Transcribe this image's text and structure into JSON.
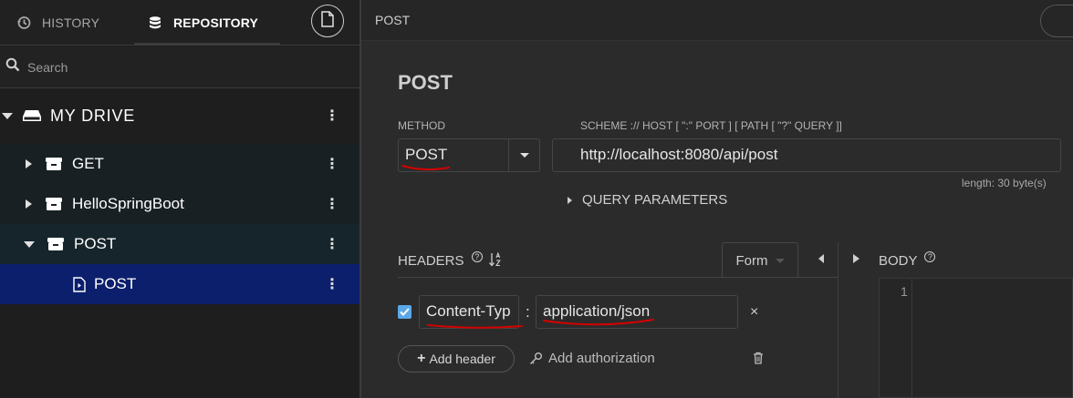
{
  "sidebar": {
    "tabs": {
      "history": "HISTORY",
      "repository": "REPOSITORY"
    },
    "search_placeholder": "Search",
    "drive_label": "MY DRIVE",
    "tree": [
      {
        "label": "GET",
        "expanded": false
      },
      {
        "label": "HelloSpringBoot",
        "expanded": false
      },
      {
        "label": "POST",
        "expanded": true
      }
    ],
    "selected_request": "POST"
  },
  "topbar": {
    "title": "POST"
  },
  "request": {
    "title": "POST",
    "method_label": "METHOD",
    "method": "POST",
    "url_label": "SCHEME :// HOST [ \":\" PORT ] [ PATH [ \"?\" QUERY ]]",
    "url": "http://localhost:8080/api/post",
    "length": "length: 30 byte(s)",
    "query_params_label": "QUERY PARAMETERS"
  },
  "headers": {
    "label": "HEADERS",
    "mode": "Form",
    "items": [
      {
        "enabled": true,
        "key": "Content-Typ",
        "value": "application/json"
      }
    ],
    "add_header": "Add header",
    "add_authorization": "Add authorization"
  },
  "body": {
    "label": "BODY",
    "line_number": "1"
  },
  "colors": {
    "selected_row": "#0c1f6c",
    "checkbox": "#5ba8e8",
    "annotation": "#d40000"
  }
}
